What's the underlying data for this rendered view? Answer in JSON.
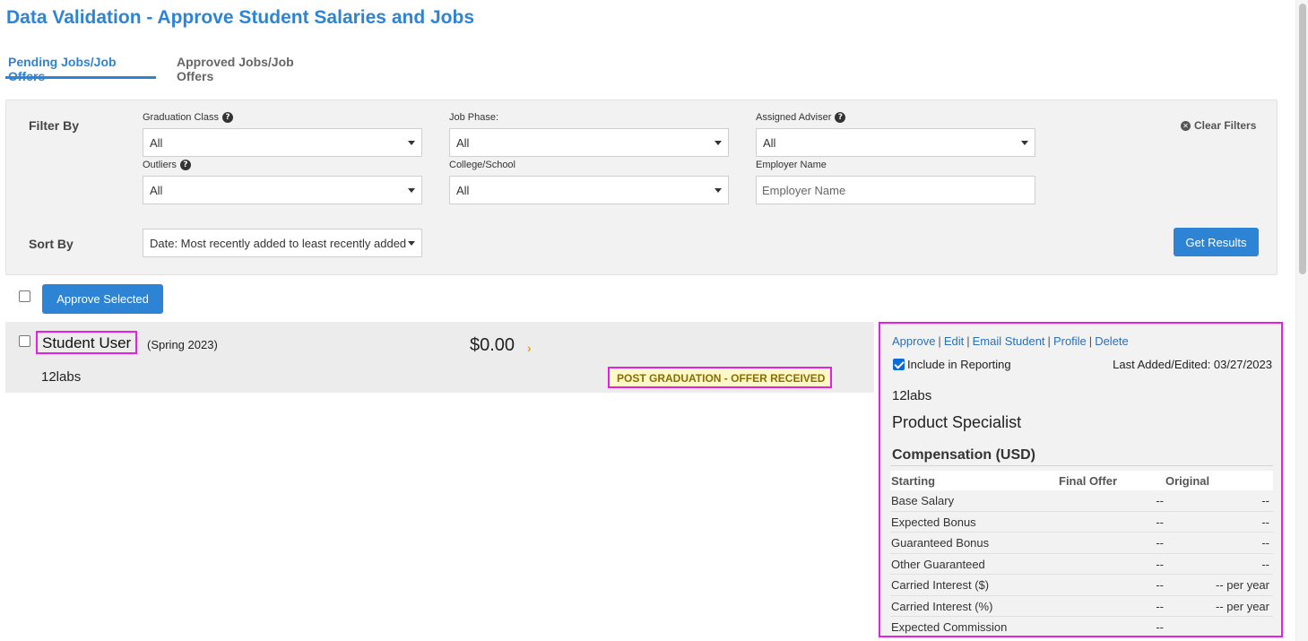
{
  "page_title": "Data Validation - Approve Student Salaries and Jobs",
  "tabs": [
    {
      "label": "Pending Jobs/Job Offers",
      "active": true
    },
    {
      "label": "Approved Jobs/Job Offers",
      "active": false
    }
  ],
  "filters": {
    "filter_by_label": "Filter By",
    "sort_by_label": "Sort By",
    "clear_filters": "Clear Filters",
    "get_results": "Get Results",
    "graduation_class": {
      "label": "Graduation Class",
      "value": "All"
    },
    "job_phase": {
      "label": "Job Phase:",
      "value": "All"
    },
    "assigned_adviser": {
      "label": "Assigned Adviser",
      "value": "All"
    },
    "outliers": {
      "label": "Outliers",
      "value": "All"
    },
    "college_school": {
      "label": "College/School",
      "value": "All"
    },
    "employer_name": {
      "label": "Employer Name",
      "placeholder": "Employer Name"
    },
    "sort": {
      "value": "Date: Most recently added to least recently added"
    }
  },
  "bulk": {
    "approve_selected": "Approve Selected"
  },
  "result": {
    "student_name": "Student User",
    "class_year": "(Spring 2023)",
    "employer": "12labs",
    "salary": "$0.00",
    "status": "POST GRADUATION - OFFER RECEIVED"
  },
  "detail": {
    "actions": [
      "Approve",
      "Edit",
      "Email Student",
      "Profile",
      "Delete"
    ],
    "include_in_reporting": "Include in Reporting",
    "include_checked": true,
    "last_edited": "Last Added/Edited: 03/27/2023",
    "employer": "12labs",
    "job_title": "Product Specialist",
    "compensation_heading": "Compensation (USD)",
    "columns": [
      "Starting",
      "Final Offer",
      "Original"
    ],
    "rows": [
      {
        "label": "Base Salary",
        "final": "--",
        "original": "--"
      },
      {
        "label": "Expected Bonus",
        "final": "--",
        "original": "--"
      },
      {
        "label": "Guaranteed Bonus",
        "final": "--",
        "original": "--"
      },
      {
        "label": "Other Guaranteed",
        "final": "--",
        "original": "--"
      },
      {
        "label": "Carried Interest ($)",
        "final": "--",
        "original": "-- per year"
      },
      {
        "label": "Carried Interest (%)",
        "final": "--",
        "original": "-- per year"
      },
      {
        "label": "Expected Commission",
        "final": "--",
        "original": ""
      }
    ]
  },
  "colors": {
    "accent": "#2d84d4",
    "highlight_border": "#e61ee6",
    "badge_bg": "#fff9c9",
    "chevron": "#e8a317"
  }
}
